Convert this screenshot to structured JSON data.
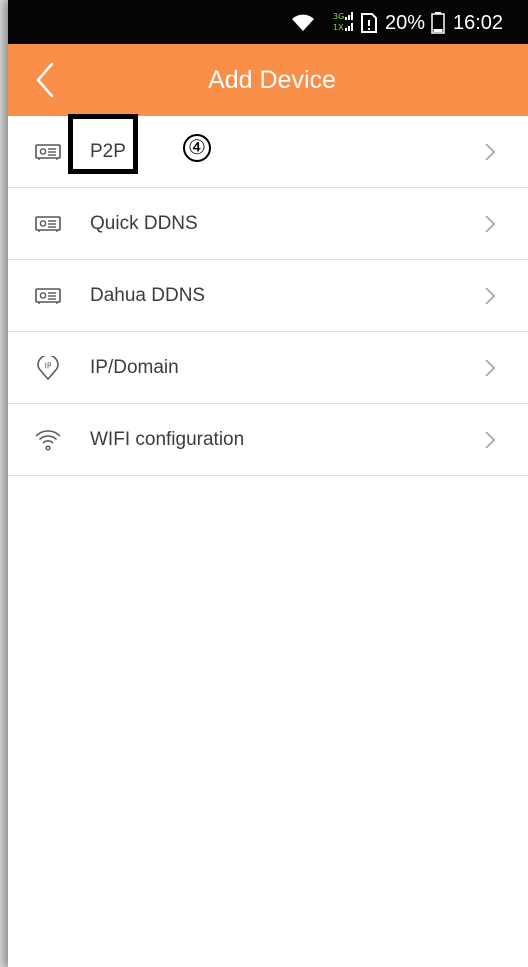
{
  "status_bar": {
    "network_label": "3G 1X",
    "battery_percent": "20%",
    "time": "16:02",
    "icons": [
      "wifi-icon",
      "signal-icon",
      "sim-icon",
      "battery-icon"
    ]
  },
  "header": {
    "title": "Add Device",
    "back_icon": "chevron-left-icon",
    "background_color": "#f98e48"
  },
  "list": {
    "items": [
      {
        "label": "P2P",
        "icon": "device-icon"
      },
      {
        "label": "Quick DDNS",
        "icon": "device-icon"
      },
      {
        "label": "Dahua DDNS",
        "icon": "device-icon"
      },
      {
        "label": "IP/Domain",
        "icon": "ip-pin-icon"
      },
      {
        "label": "WIFI configuration",
        "icon": "wifi-config-icon"
      }
    ]
  },
  "annotation": {
    "step_number": "④",
    "highlighted_item": "P2P"
  }
}
